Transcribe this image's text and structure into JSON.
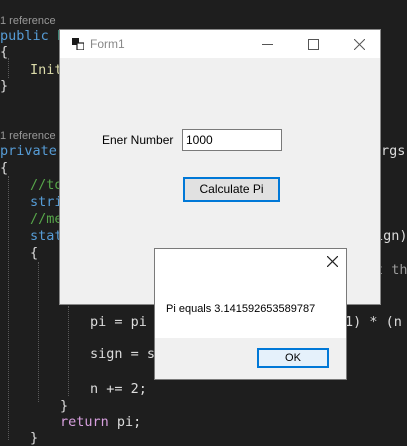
{
  "editor": {
    "codelens_1": "1 reference",
    "codelens_2": "1 reference",
    "line_public_kw": "public",
    "line_public_id": "F",
    "brace_open_1": "{",
    "init_call": "Init",
    "brace_close_1": "}",
    "line_private_kw": "private",
    "line_private_args": "rgs",
    "brace_open_2": "{",
    "comment_to": "//to",
    "strin_kw": "strin",
    "comment_me": "//me",
    "stat_kw": "stat",
    "sign_frag": "ign)",
    "brace_open_3": "{",
    "t_th_frag": "t th",
    "pi_assign_left": "pi = pi",
    "pi_assign_right": "1) * (n",
    "sign_assign": "sign = si",
    "n_increment": "n += 2;",
    "brace_close_inner": "}",
    "return_kw": "return",
    "return_val": "pi;",
    "brace_close_outer": "}"
  },
  "form1": {
    "title": "Form1",
    "label": "Ener Number",
    "input_value": "1000",
    "button_label": "Calculate Pi"
  },
  "messagebox": {
    "message": "Pi equals 3.141592653589787",
    "ok_label": "OK"
  },
  "icons": {
    "minimize": "minimize-icon",
    "maximize": "maximize-icon",
    "close": "close-icon"
  }
}
